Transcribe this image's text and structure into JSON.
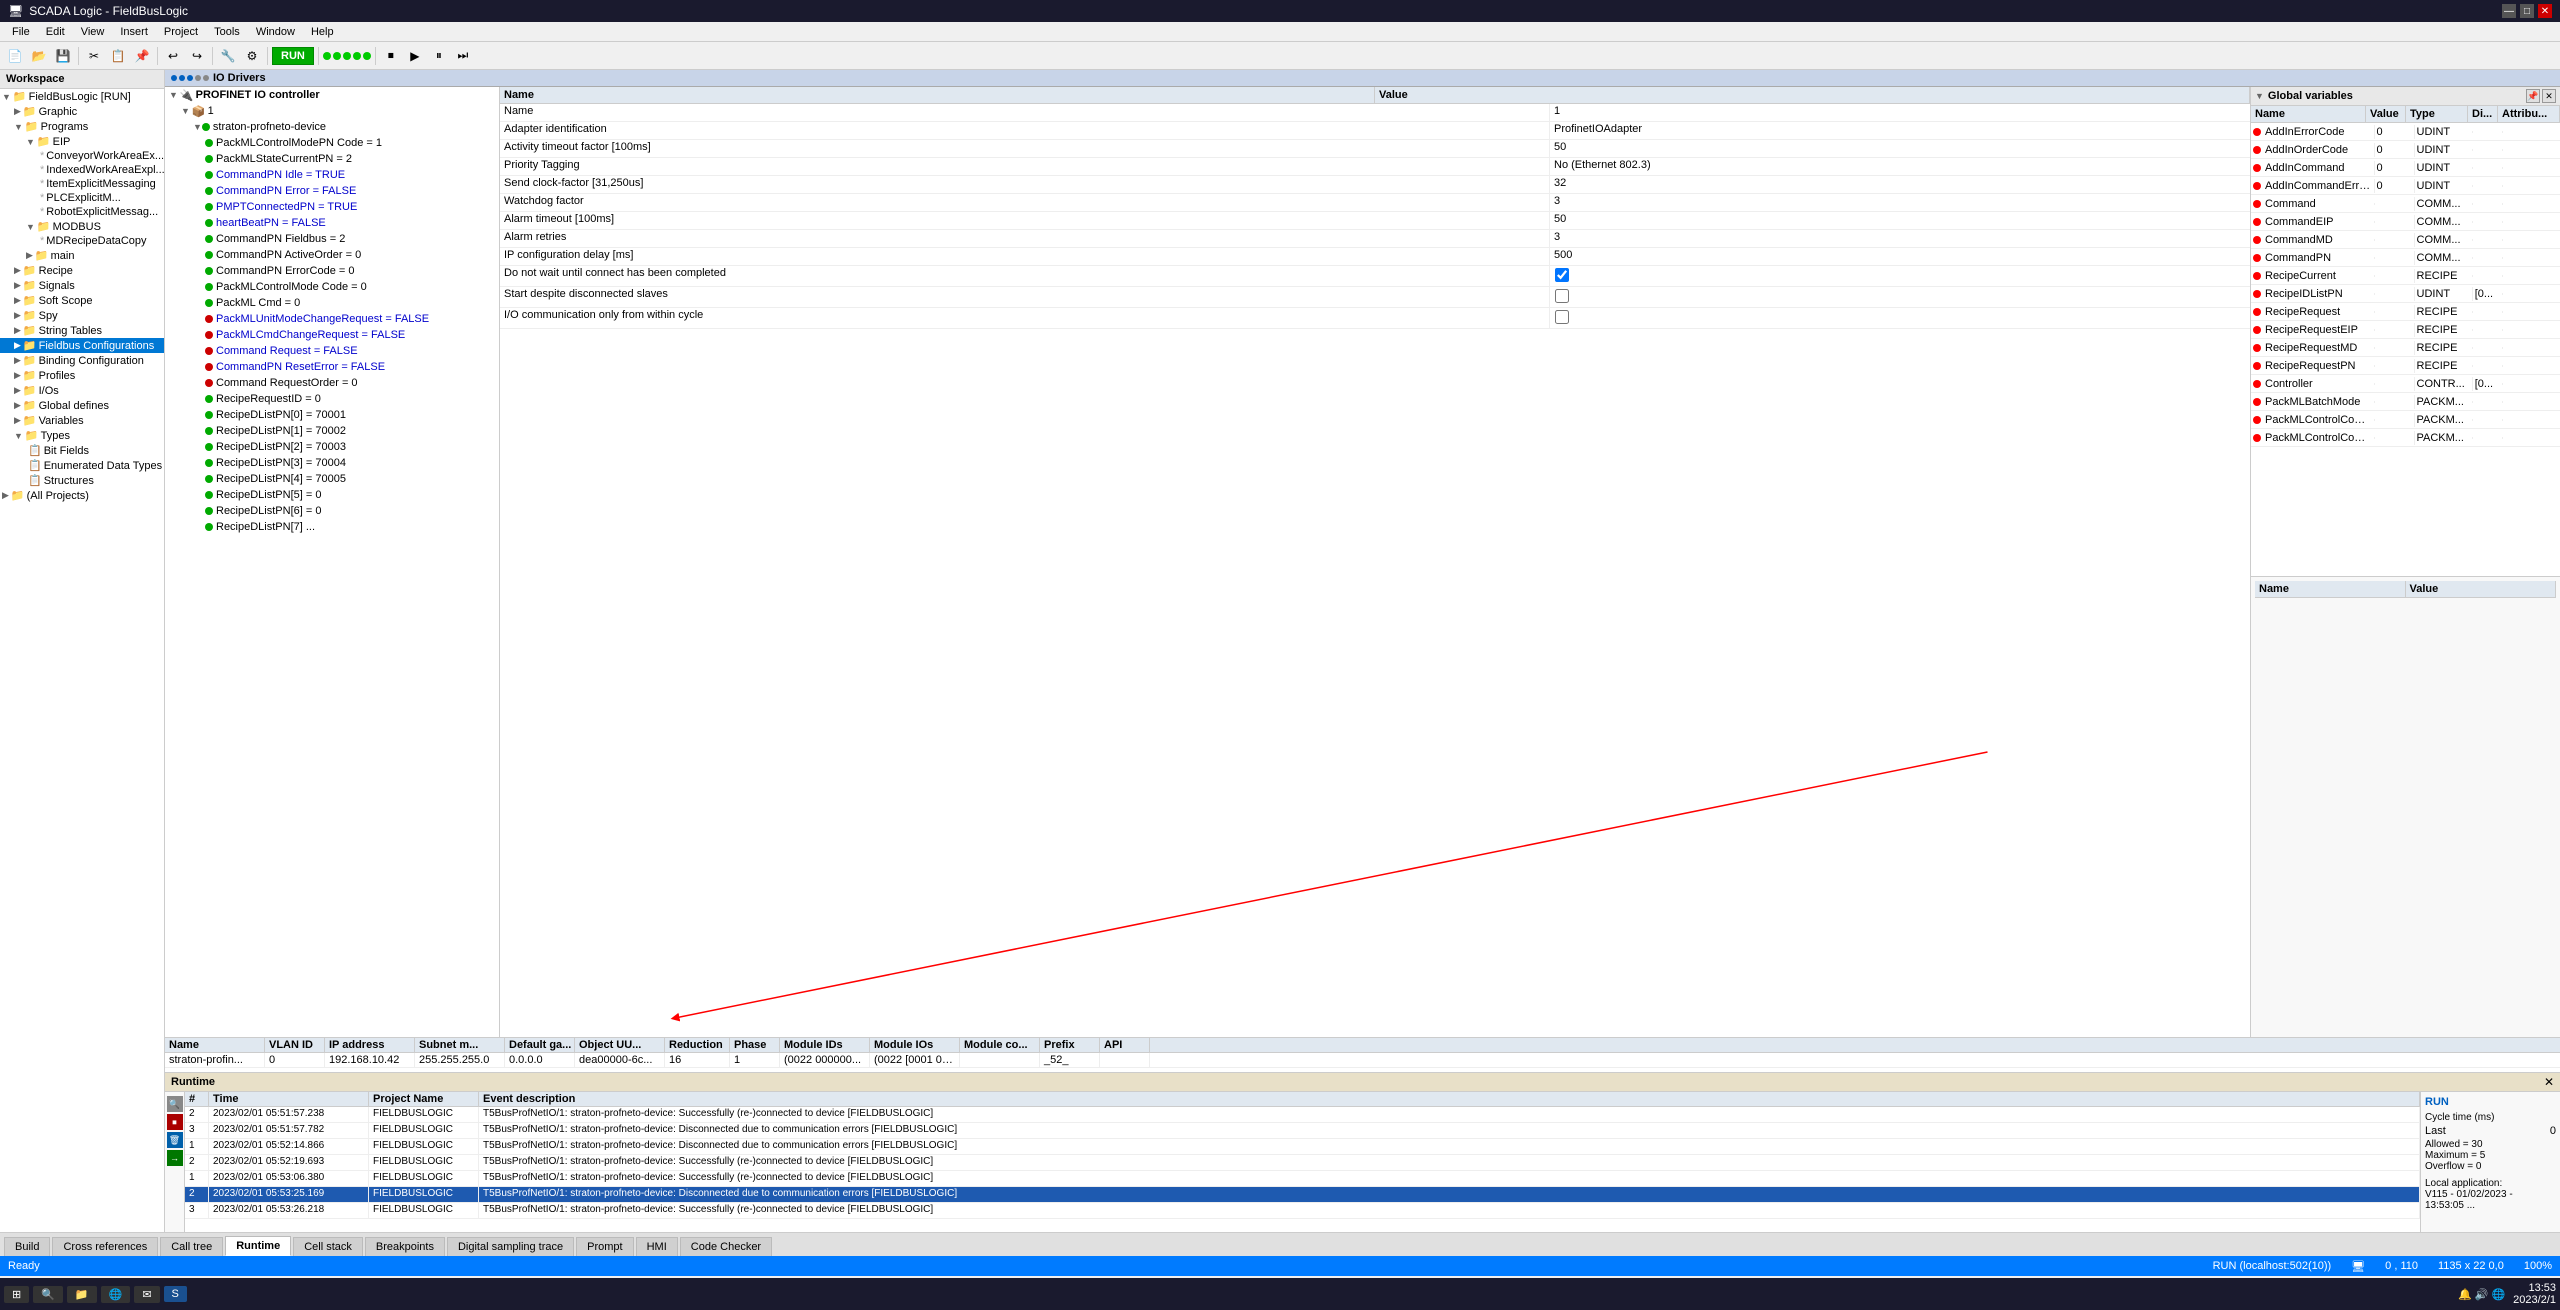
{
  "titleBar": {
    "title": "SCADA Logic - FieldBusLogic",
    "controls": [
      "—",
      "□",
      "✕"
    ]
  },
  "menuBar": {
    "items": [
      "File",
      "Edit",
      "View",
      "Insert",
      "Project",
      "Tools",
      "Window",
      "Help"
    ]
  },
  "toolbar": {
    "runLabel": "RUN",
    "runColor": "#00aa00"
  },
  "workspace": {
    "title": "Workspace",
    "items": [
      {
        "label": "FieldBusLogic [RUN]",
        "level": 0,
        "type": "root",
        "expanded": true
      },
      {
        "label": "Graphic",
        "level": 1,
        "type": "folder",
        "expanded": true
      },
      {
        "label": "Programs",
        "level": 1,
        "type": "folder",
        "expanded": true
      },
      {
        "label": "EIP",
        "level": 2,
        "type": "folder",
        "expanded": true
      },
      {
        "label": "ConveyorWorkAreaEx...",
        "level": 3,
        "type": "item"
      },
      {
        "label": "IndexedWorkAreaExpl...",
        "level": 3,
        "type": "item"
      },
      {
        "label": "ItemExplicitMessaging",
        "level": 3,
        "type": "item"
      },
      {
        "label": "PLCExplicitM...",
        "level": 3,
        "type": "item"
      },
      {
        "label": "RobotExplicitMessag...",
        "level": 3,
        "type": "item"
      },
      {
        "label": "MODBUS",
        "level": 2,
        "type": "folder",
        "expanded": true
      },
      {
        "label": "MDRecipeDataCopy",
        "level": 3,
        "type": "item"
      },
      {
        "label": "main",
        "level": 2,
        "type": "folder"
      },
      {
        "label": "Recipe",
        "level": 1,
        "type": "folder"
      },
      {
        "label": "Signals",
        "level": 1,
        "type": "folder"
      },
      {
        "label": "Soft Scope",
        "level": 1,
        "type": "folder"
      },
      {
        "label": "Spy",
        "level": 1,
        "type": "folder"
      },
      {
        "label": "String Tables",
        "level": 1,
        "type": "folder"
      },
      {
        "label": "Fieldbus Configurations",
        "level": 1,
        "type": "folder",
        "selected": true
      },
      {
        "label": "Binding Configuration",
        "level": 1,
        "type": "folder"
      },
      {
        "label": "Profiles",
        "level": 1,
        "type": "folder"
      },
      {
        "label": "I/Os",
        "level": 1,
        "type": "folder"
      },
      {
        "label": "Global defines",
        "level": 1,
        "type": "folder"
      },
      {
        "label": "Variables",
        "level": 1,
        "type": "folder"
      },
      {
        "label": "Types",
        "level": 1,
        "type": "folder",
        "expanded": true
      },
      {
        "label": "Bit Fields",
        "level": 2,
        "type": "item"
      },
      {
        "label": "Enumerated Data Types",
        "level": 2,
        "type": "item"
      },
      {
        "label": "Structures",
        "level": 2,
        "type": "item"
      },
      {
        "label": "(All Projects)",
        "level": 0,
        "type": "folder"
      }
    ]
  },
  "ioDrivers": {
    "title": "IO Drivers",
    "deviceTree": {
      "items": [
        {
          "label": "PROFINET IO controller",
          "level": 0,
          "expanded": true,
          "indicator": null
        },
        {
          "label": "1",
          "level": 1,
          "expanded": true,
          "indicator": null
        },
        {
          "label": "straton-profneto-device",
          "level": 2,
          "expanded": true,
          "indicator": "green"
        },
        {
          "label": "PackMLControlModePN Code = 1",
          "level": 3,
          "indicator": "green"
        },
        {
          "label": "PackMLStateCurrentPN = 2",
          "level": 3,
          "indicator": "green"
        },
        {
          "label": "CommandPN Idle = TRUE",
          "level": 3,
          "indicator": "green",
          "highlight": "blue"
        },
        {
          "label": "CommandPN Error = FALSE",
          "level": 3,
          "indicator": "green",
          "highlight": "blue"
        },
        {
          "label": "PMPTConnectedPN = TRUE",
          "level": 3,
          "indicator": "green",
          "highlight": "blue"
        },
        {
          "label": "heartBeatPN = FALSE",
          "level": 3,
          "indicator": "green",
          "highlight": "blue"
        },
        {
          "label": "CommandPN Fieldbus = 2",
          "level": 3,
          "indicator": "green"
        },
        {
          "label": "CommandPN ActiveOrder = 0",
          "level": 3,
          "indicator": "green"
        },
        {
          "label": "CommandPN ErrorCode = 0",
          "level": 3,
          "indicator": "green"
        },
        {
          "label": "PackMLControlMode Code = 0",
          "level": 3,
          "indicator": "green"
        },
        {
          "label": "PackML Cmd = 0",
          "level": 3,
          "indicator": "green"
        },
        {
          "label": "PackMLUnitModeChangeRequest = FALSE",
          "level": 3,
          "indicator": "red",
          "highlight": "blue"
        },
        {
          "label": "PackMLCmdChangeRequest = FALSE",
          "level": 3,
          "indicator": "red",
          "highlight": "blue"
        },
        {
          "label": "Command Request = FALSE",
          "level": 3,
          "indicator": "red",
          "highlight": "blue"
        },
        {
          "label": "CommandPN ResetError = FALSE",
          "level": 3,
          "indicator": "red",
          "highlight": "blue"
        },
        {
          "label": "Command RequestOrder = 0",
          "level": 3,
          "indicator": "red"
        },
        {
          "label": "RecipeRequestID = 0",
          "level": 3,
          "indicator": "green"
        },
        {
          "label": "RecipeDListPN[0] = 70001",
          "level": 3,
          "indicator": "green"
        },
        {
          "label": "RecipeDListPN[1] = 70002",
          "level": 3,
          "indicator": "green"
        },
        {
          "label": "RecipeDListPN[2] = 70003",
          "level": 3,
          "indicator": "green"
        },
        {
          "label": "RecipeDListPN[3] = 70004",
          "level": 3,
          "indicator": "green"
        },
        {
          "label": "RecipeDListPN[4] = 70005",
          "level": 3,
          "indicator": "green"
        },
        {
          "label": "RecipeDListPN[5] = 0",
          "level": 3,
          "indicator": "green"
        },
        {
          "label": "RecipeDListPN[6] = 0",
          "level": 3,
          "indicator": "green"
        },
        {
          "label": "RecipeDListPN[7] ...",
          "level": 3,
          "indicator": "green"
        }
      ]
    },
    "properties": {
      "columns": [
        "Name",
        "Value"
      ],
      "rows": [
        {
          "name": "Name",
          "value": "1",
          "type": "text"
        },
        {
          "name": "Adapter identification",
          "value": "ProfinetIOAdapter",
          "type": "text"
        },
        {
          "name": "Activity timeout factor [100ms]",
          "value": "50",
          "type": "text"
        },
        {
          "name": "Priority Tagging",
          "value": "No (Ethernet 802.3)",
          "type": "text"
        },
        {
          "name": "Send clock-factor [31,250us]",
          "value": "32",
          "type": "text"
        },
        {
          "name": "Watchdog factor",
          "value": "3",
          "type": "text"
        },
        {
          "name": "Alarm timeout [100ms]",
          "value": "50",
          "type": "text"
        },
        {
          "name": "Alarm retries",
          "value": "3",
          "type": "text"
        },
        {
          "name": "IP configuration delay [ms]",
          "value": "500",
          "type": "text"
        },
        {
          "name": "Do not wait until connect has been completed",
          "value": "",
          "type": "checkbox",
          "checked": true
        },
        {
          "name": "Start despite disconnected slaves",
          "value": "",
          "type": "checkbox",
          "checked": false
        },
        {
          "name": "I/O communication only from within cycle",
          "value": "",
          "type": "checkbox",
          "checked": false
        }
      ]
    },
    "tableColumns": [
      "Name",
      "VLAN ID",
      "IP address",
      "Subnet m...",
      "Default ga...",
      "Object UU...",
      "Reduction",
      "Phase",
      "Module IDs",
      "Module IOs",
      "Module co...",
      "Prefix",
      "API"
    ],
    "tableRow": {
      "name": "straton-profin...",
      "vlanId": "0",
      "ip": "192.168.10.42",
      "subnet": "255.255.255.0",
      "gateway": "0.0.0.0",
      "objUuid": "dea00000-6c...",
      "reduction": "16",
      "phase": "1",
      "moduleIds": "(0022 000000...",
      "moduleIos": "(0022 [0001 01...",
      "moduleCo": "",
      "prefix": "_52_",
      "api": ""
    }
  },
  "rightPanel": {
    "title": "Global variables",
    "columns": [
      "Name",
      "Value",
      "Type",
      "Di...",
      "Attribu..."
    ],
    "variables": [
      {
        "name": "AddInErrorCode",
        "value": "0",
        "type": "UDINT",
        "di": "",
        "attr": ""
      },
      {
        "name": "AddInOrderCode",
        "value": "0",
        "type": "UDINT",
        "di": "",
        "attr": ""
      },
      {
        "name": "AddInCommand",
        "value": "0",
        "type": "UDINT",
        "di": "",
        "attr": ""
      },
      {
        "name": "AddInCommandErrorCode",
        "value": "0",
        "type": "UDINT",
        "di": "",
        "attr": ""
      },
      {
        "name": "Command",
        "value": "",
        "type": "COMM...",
        "di": "",
        "attr": ""
      },
      {
        "name": "CommandEIP",
        "value": "",
        "type": "COMM...",
        "di": "",
        "attr": ""
      },
      {
        "name": "CommandMD",
        "value": "",
        "type": "COMM...",
        "di": "",
        "attr": ""
      },
      {
        "name": "CommandPN",
        "value": "",
        "type": "COMM...",
        "di": "",
        "attr": ""
      },
      {
        "name": "RecipeCurrent",
        "value": "",
        "type": "RECIPE",
        "di": "",
        "attr": ""
      },
      {
        "name": "RecipeIDListPN",
        "value": "",
        "type": "UDINT",
        "di": "[0...",
        "attr": ""
      },
      {
        "name": "RecipeRequest",
        "value": "",
        "type": "RECIPE",
        "di": "",
        "attr": ""
      },
      {
        "name": "RecipeRequestEIP",
        "value": "",
        "type": "RECIPE",
        "di": "",
        "attr": ""
      },
      {
        "name": "RecipeRequestMD",
        "value": "",
        "type": "RECIPE",
        "di": "",
        "attr": ""
      },
      {
        "name": "RecipeRequestPN",
        "value": "",
        "type": "RECIPE",
        "di": "",
        "attr": ""
      },
      {
        "name": "Controller",
        "value": "",
        "type": "CONTR...",
        "di": "[0...",
        "attr": ""
      },
      {
        "name": "PackMLBatchMode",
        "value": "",
        "type": "PACKM...",
        "di": "",
        "attr": ""
      },
      {
        "name": "PackMLControlCommand",
        "value": "",
        "type": "PACKM...",
        "di": "",
        "attr": ""
      },
      {
        "name": "PackMLControlCommandButton",
        "value": "",
        "type": "PACKM...",
        "di": "",
        "attr": ""
      }
    ],
    "bottomColumns": [
      "Name",
      "Value"
    ]
  },
  "runtime": {
    "title": "Runtime",
    "columns": [
      "#",
      "Time",
      "Project Name",
      "Event description"
    ],
    "logs": [
      {
        "num": "2",
        "time": "2023/02/01 05:51:57.238",
        "project": "FIELDBUSLOGIC",
        "event": "T5BusProfNetIO/1: straton-profneto-device: Successfully (re-)connected to device [FIELDBUSLOGIC]",
        "highlighted": false
      },
      {
        "num": "3",
        "time": "2023/02/01 05:51:57.782",
        "project": "FIELDBUSLOGIC",
        "event": "T5BusProfNetIO/1: straton-profneto-device: Disconnected due to communication errors [FIELDBUSLOGIC]",
        "highlighted": false
      },
      {
        "num": "1",
        "time": "2023/02/01 05:52:14.866",
        "project": "FIELDBUSLOGIC",
        "event": "T5BusProfNetIO/1: straton-profneto-device: Disconnected due to communication errors [FIELDBUSLOGIC]",
        "highlighted": false
      },
      {
        "num": "2",
        "time": "2023/02/01 05:52:19.693",
        "project": "FIELDBUSLOGIC",
        "event": "T5BusProfNetIO/1: straton-profneto-device: Successfully (re-)connected to device [FIELDBUSLOGIC]",
        "highlighted": false
      },
      {
        "num": "1",
        "time": "2023/02/01 05:53:06.380",
        "project": "FIELDBUSLOGIC",
        "event": "T5BusProfNetIO/1: straton-profneto-device: Successfully (re-)connected to device [FIELDBUSLOGIC]",
        "highlighted": false
      },
      {
        "num": "2",
        "time": "2023/02/01 05:53:25.169",
        "project": "FIELDBUSLOGIC",
        "event": "T5BusProfNetIO/1: straton-profneto-device: Disconnected due to communication errors [FIELDBUSLOGIC]",
        "highlighted": true
      },
      {
        "num": "3",
        "time": "2023/02/01 05:53:26.218",
        "project": "FIELDBUSLOGIC",
        "event": "T5BusProfNetIO/1: straton-profneto-device: Successfully (re-)connected to device [FIELDBUSLOGIC]",
        "highlighted": false
      }
    ],
    "stats": {
      "title": "RUN",
      "cycleTimeLabel": "Cycle time (ms)",
      "lastLabel": "Last",
      "lastValue": "0",
      "allowedLabel": "Allowed = 30",
      "maximumLabel": "Maximum = 5",
      "overflowLabel": "Overflow = 0",
      "localAppLabel": "Local application:",
      "versionLabel": "V115 - 01/02/2023 -",
      "timeLabel": "13:53:05 ..."
    }
  },
  "bottomTabs": {
    "tabs": [
      "Build",
      "Cross references",
      "Call tree",
      "Runtime",
      "Cell stack",
      "Breakpoints",
      "Digital sampling trace",
      "Prompt",
      "HMI",
      "Code Checker"
    ],
    "active": "Runtime"
  },
  "statusBar": {
    "readyLabel": "Ready",
    "runLabel": "RUN (localhost:502(10))",
    "coords": "0 , 110",
    "dimensions": "1135 x 22  0,0",
    "zoom": "100%"
  },
  "taskbar": {
    "time": "13:53",
    "date": "2023/2/1"
  }
}
